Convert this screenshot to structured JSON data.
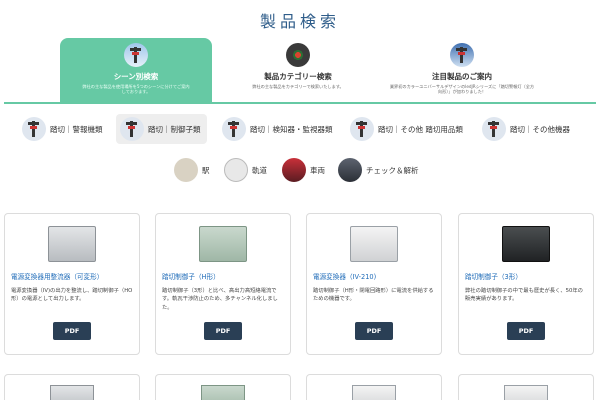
{
  "page": {
    "title": "製品検索"
  },
  "tabs": [
    {
      "title": "シーン別検索",
      "desc": "弊社の主な製品を使用場所を5つのシーンに分けてご案内しております。",
      "active": true
    },
    {
      "title": "製品カテゴリー検索",
      "desc": "弊社の主な製品をカテゴリーで検索いたします。",
      "active": false
    },
    {
      "title": "注目製品のご案内",
      "desc": "業界初のカラーユニバーサルデザインのledJRシリーズに「踏切警報灯（全方向形）」が加わりました！",
      "active": false
    }
  ],
  "scenes_row1": [
    {
      "label": "踏切｜警報機類",
      "active": false
    },
    {
      "label": "踏切｜制御子類",
      "active": true
    },
    {
      "label": "踏切｜検知器・監視器類",
      "active": false
    },
    {
      "label": "踏切｜その他 踏切用品類",
      "active": false
    },
    {
      "label": "踏切｜その他機器",
      "active": false
    }
  ],
  "scenes_row2": [
    {
      "label": "駅"
    },
    {
      "label": "軌道"
    },
    {
      "label": "車両"
    },
    {
      "label": "チェック＆解析"
    }
  ],
  "products": [
    {
      "name": "電源変換器用整流器（可変形）",
      "desc": "電源変換器（IV)の出力を整流し、踏切制御子（HO形）の電源として出力します。",
      "pdf_label": "PDF"
    },
    {
      "name": "踏切制御子（H形）",
      "desc": "踏切制御子（3形）と比べ、高出力高短絡電流です。軌瓦干渉防止のため、多チャンネル化しました。",
      "pdf_label": "PDF"
    },
    {
      "name": "電源変換器（IV-210)",
      "desc": "踏切制御子（H形・閉電回路形）に電流を供給するための機器です。",
      "pdf_label": "PDF"
    },
    {
      "name": "踏切制御子（3形）",
      "desc": "弊社の踏切制御子の中で最も歴史が長く、50年の販売実績があります。",
      "pdf_label": "PDF"
    }
  ]
}
